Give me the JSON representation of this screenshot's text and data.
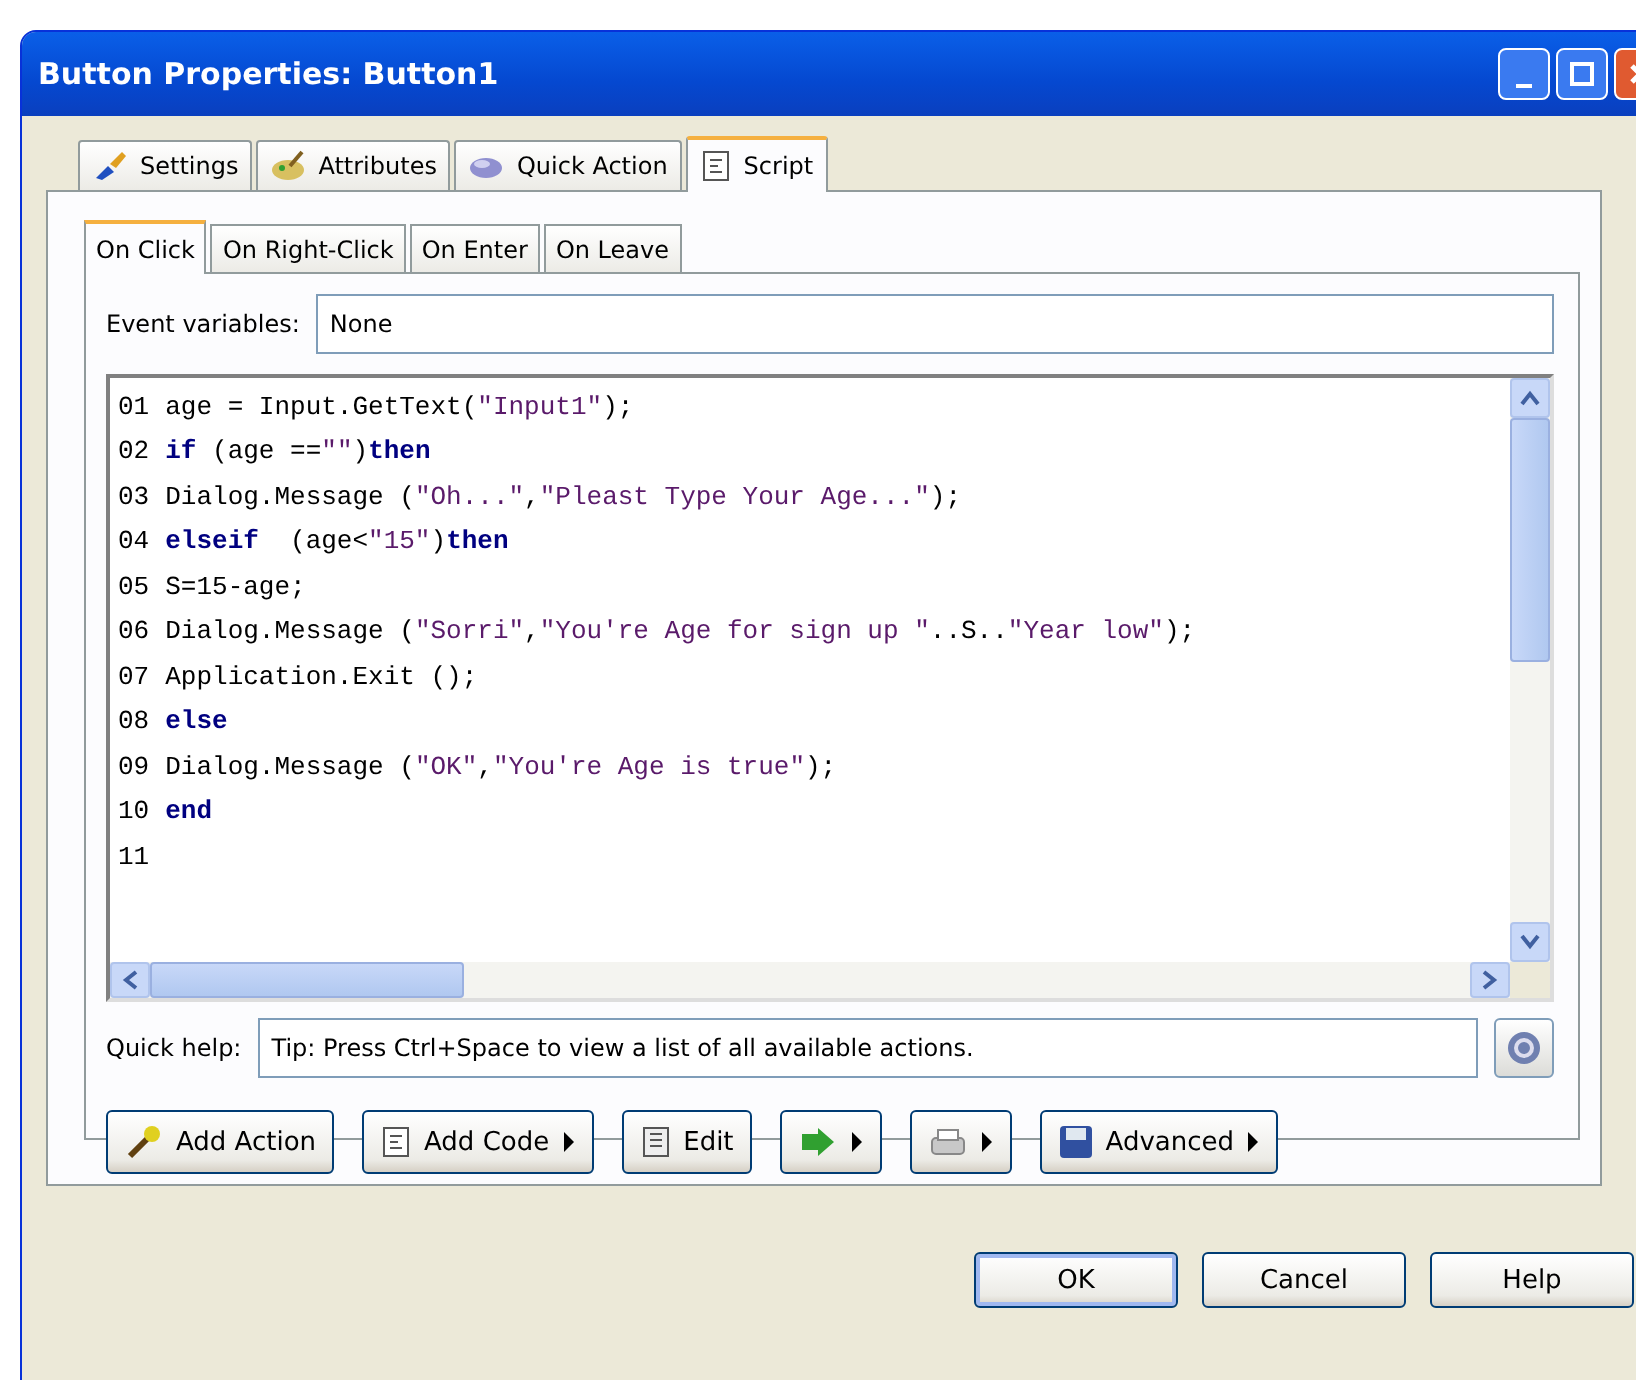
{
  "window": {
    "title": "Button Properties: Button1"
  },
  "tabs": [
    {
      "label": "Settings",
      "selected": false
    },
    {
      "label": "Attributes",
      "selected": false
    },
    {
      "label": "Quick Action",
      "selected": false
    },
    {
      "label": "Script",
      "selected": true
    }
  ],
  "event_tabs": [
    {
      "label": "On Click",
      "selected": true
    },
    {
      "label": "On Right-Click",
      "selected": false
    },
    {
      "label": "On Enter",
      "selected": false
    },
    {
      "label": "On Leave",
      "selected": false
    }
  ],
  "event_variables": {
    "label": "Event variables:",
    "value": "None"
  },
  "code_lines": [
    {
      "number": "01",
      "tokens": [
        {
          "kind": "plain",
          "text": "age = Input.GetText("
        },
        {
          "kind": "string",
          "text": "\"Input1\""
        },
        {
          "kind": "plain",
          "text": ");"
        }
      ]
    },
    {
      "number": "02",
      "tokens": [
        {
          "kind": "keyword",
          "text": "if"
        },
        {
          "kind": "plain",
          "text": " (age =="
        },
        {
          "kind": "string",
          "text": "\"\""
        },
        {
          "kind": "plain",
          "text": ")"
        },
        {
          "kind": "keyword",
          "text": "then"
        }
      ]
    },
    {
      "number": "03",
      "tokens": [
        {
          "kind": "plain",
          "text": "Dialog.Message ("
        },
        {
          "kind": "string",
          "text": "\"Oh...\""
        },
        {
          "kind": "plain",
          "text": ","
        },
        {
          "kind": "string",
          "text": "\"Pleast Type Your Age...\""
        },
        {
          "kind": "plain",
          "text": ");"
        }
      ]
    },
    {
      "number": "04",
      "tokens": [
        {
          "kind": "keyword",
          "text": "elseif"
        },
        {
          "kind": "plain",
          "text": "  (age<"
        },
        {
          "kind": "string",
          "text": "\"15\""
        },
        {
          "kind": "plain",
          "text": ")"
        },
        {
          "kind": "keyword",
          "text": "then"
        }
      ]
    },
    {
      "number": "05",
      "tokens": [
        {
          "kind": "plain",
          "text": "S=15-age;"
        }
      ]
    },
    {
      "number": "06",
      "tokens": [
        {
          "kind": "plain",
          "text": "Dialog.Message ("
        },
        {
          "kind": "string",
          "text": "\"Sorri\""
        },
        {
          "kind": "plain",
          "text": ","
        },
        {
          "kind": "string",
          "text": "\"You're Age for sign up \""
        },
        {
          "kind": "plain",
          "text": "..S.."
        },
        {
          "kind": "string",
          "text": "\"Year low\""
        },
        {
          "kind": "plain",
          "text": ");"
        }
      ]
    },
    {
      "number": "07",
      "tokens": [
        {
          "kind": "plain",
          "text": "Application.Exit ();"
        }
      ]
    },
    {
      "number": "08",
      "tokens": [
        {
          "kind": "keyword",
          "text": "else"
        }
      ]
    },
    {
      "number": "09",
      "tokens": [
        {
          "kind": "plain",
          "text": "Dialog.Message ("
        },
        {
          "kind": "string",
          "text": "\"OK\""
        },
        {
          "kind": "plain",
          "text": ","
        },
        {
          "kind": "string",
          "text": "\"You're Age is true\""
        },
        {
          "kind": "plain",
          "text": ");"
        }
      ]
    },
    {
      "number": "10",
      "tokens": [
        {
          "kind": "keyword",
          "text": "end"
        }
      ]
    },
    {
      "number": "11"
    }
  ],
  "quick_help": {
    "label": "Quick help:",
    "value": "Tip: Press Ctrl+Space to view a list of all available actions."
  },
  "toolbar": [
    {
      "label": "Add Action",
      "has_menu": false
    },
    {
      "label": "Add Code",
      "has_menu": true
    },
    {
      "label": "Edit",
      "has_menu": false
    },
    {
      "has_menu": true
    },
    {
      "has_menu": true
    },
    {
      "label": "Advanced",
      "has_menu": true
    }
  ],
  "dialog_buttons": [
    "OK",
    "Cancel",
    "Help"
  ]
}
